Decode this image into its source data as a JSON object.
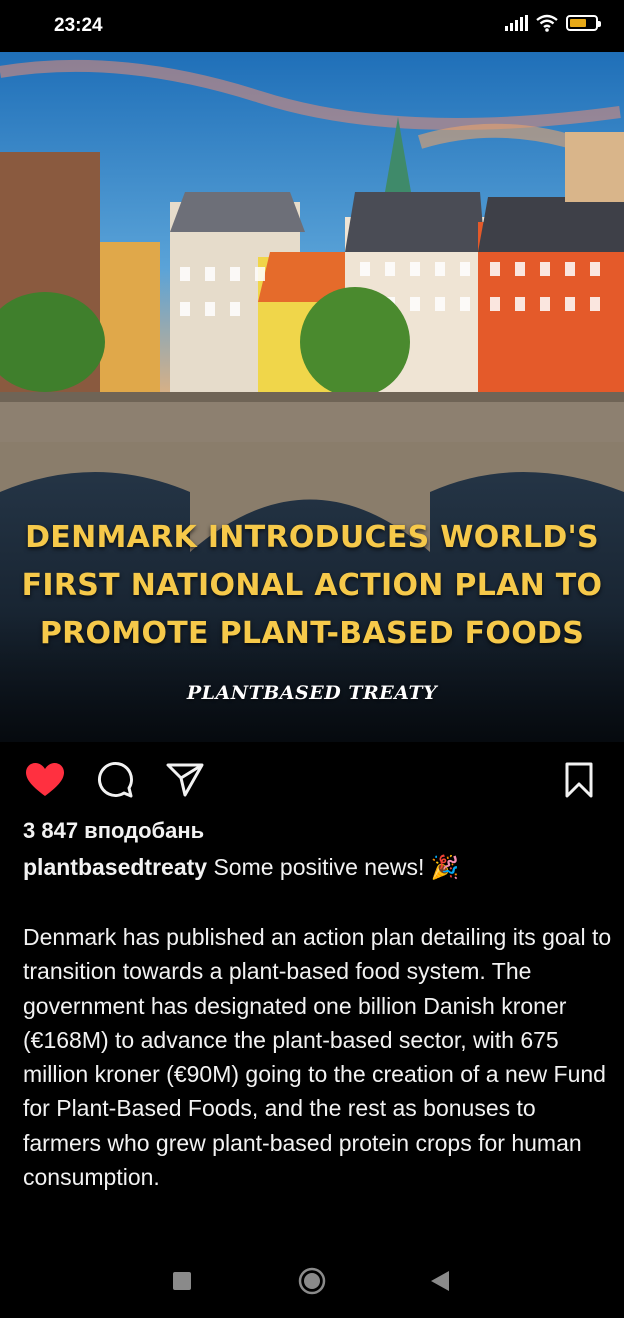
{
  "status_bar": {
    "time": "23:24",
    "icons": [
      "signal-icon",
      "wifi-icon",
      "battery-icon"
    ],
    "battery_color": "#e6a817"
  },
  "post": {
    "image": {
      "headline_lines": [
        "DENMARK INTRODUCES WORLD'S",
        "FIRST NATIONAL ACTION PLAN TO",
        "PROMOTE PLANT-BASED FOODS"
      ],
      "brand_text": "PLANTBASED TREATY",
      "headline_color": "#f6c94a"
    },
    "actions": {
      "icons": [
        "heart-icon",
        "comment-icon",
        "share-icon",
        "bookmark-icon"
      ],
      "liked": true,
      "like_color": "#ff3040"
    },
    "likes_text": "3 847 вподобань",
    "caption": {
      "username": "plantbasedtreaty",
      "first_line": "Some positive news! 🎉",
      "body": "Denmark has published an action plan detailing its goal to transition towards a plant-based food system. The government has designated one billion Danish kroner (€168M) to advance the plant-based sector, with 675 million kroner (€90M) going to the creation of a new Fund for Plant-Based Foods, and the rest as bonuses to farmers who grew plant-based protein crops for human consumption."
    }
  },
  "nav_bar": {
    "buttons": [
      "recents-button",
      "home-button",
      "back-button"
    ]
  }
}
